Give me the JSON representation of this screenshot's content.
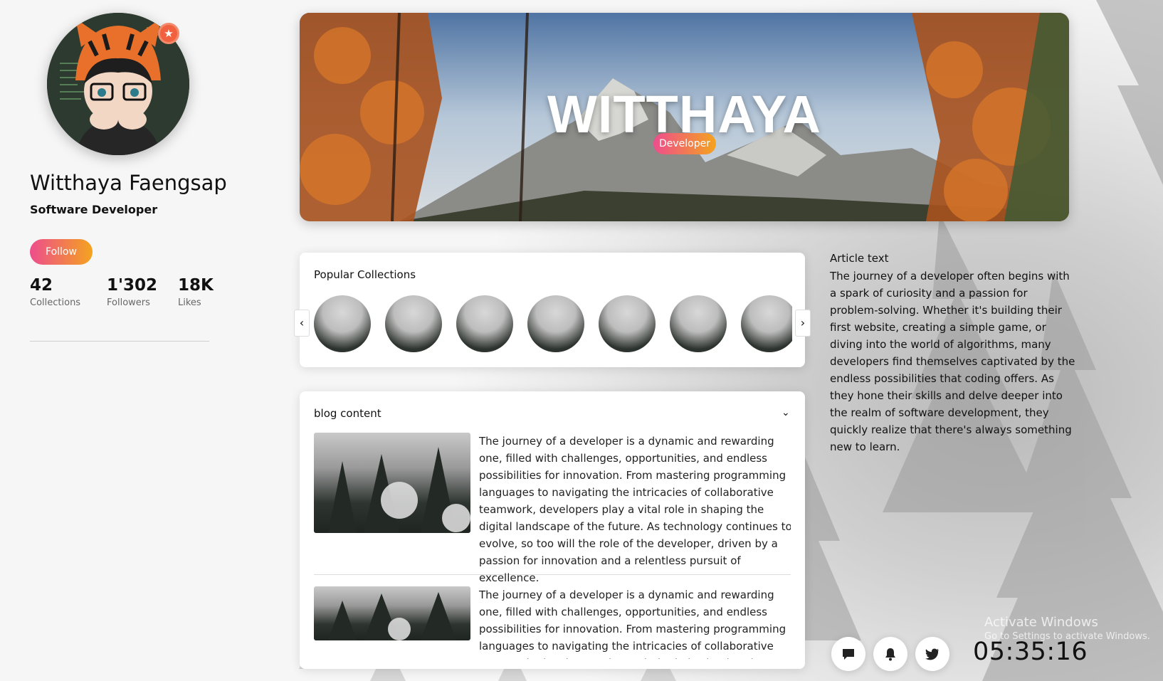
{
  "profile": {
    "name": "Witthaya Faengsap",
    "role": "Software Developer",
    "follow_label": "Follow",
    "badge_icon": "star-icon",
    "stats": [
      {
        "value": "42",
        "label": "Collections"
      },
      {
        "value": "1'302",
        "label": "Followers"
      },
      {
        "value": "18K",
        "label": "Likes"
      }
    ]
  },
  "hero": {
    "title": "WITTHAYA",
    "tag": "Developer"
  },
  "collections": {
    "title": "Popular Collections",
    "prev_icon": "chevron-left-icon",
    "next_icon": "chevron-right-icon",
    "item_count": 7
  },
  "blog": {
    "title": "blog content",
    "toggle_icon": "chevron-down-icon",
    "items": [
      {
        "text": "The journey of a developer is a dynamic and rewarding one, filled with challenges, opportunities, and endless possibilities for innovation. From mastering programming languages to navigating the intricacies of collaborative teamwork, developers play a vital role in shaping the digital landscape of the future. As technology continues to evolve, so too will the role of the developer, driven by a passion for innovation and a relentless pursuit of excellence."
      },
      {
        "text": "The journey of a developer is a dynamic and rewarding one, filled with challenges, opportunities, and endless possibilities for innovation. From mastering programming languages to navigating the intricacies of collaborative teamwork, developers play a vital role in shaping the digital landscape of the future."
      }
    ]
  },
  "article": {
    "title": "Article text",
    "body": "The journey of a developer often begins with a spark of curiosity and a passion for problem-solving. Whether it's building their first website, creating a simple game, or diving into the world of algorithms, many developers find themselves captivated by the endless possibilities that coding offers. As they hone their skills and delve deeper into the realm of software development, they quickly realize that there's always something new to learn."
  },
  "footer": {
    "buttons": [
      {
        "icon": "chat-icon"
      },
      {
        "icon": "bell-icon"
      },
      {
        "icon": "twitter-icon"
      }
    ],
    "clock": "05:35:16"
  },
  "watermark": {
    "title": "Activate Windows",
    "subtitle": "Go to Settings to activate Windows."
  },
  "colors": {
    "gradient_start": "#ee4d8e",
    "gradient_end": "#f4a31e",
    "badge": "#f1613f"
  }
}
